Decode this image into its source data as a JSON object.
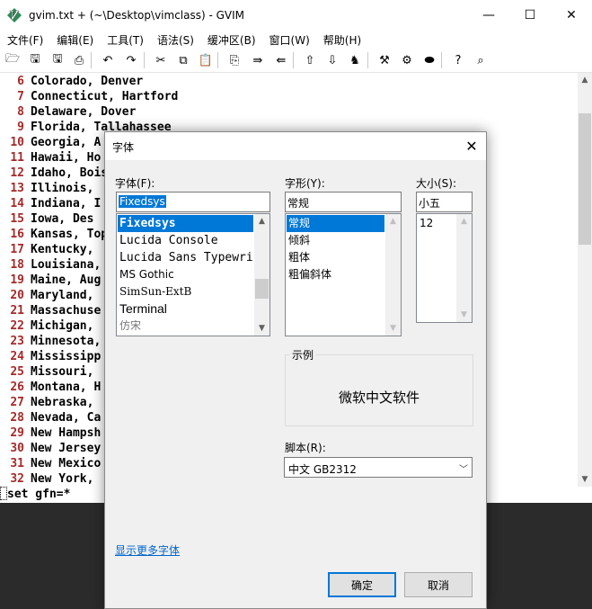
{
  "window": {
    "title": "gvim.txt + (~\\Desktop\\vimclass) - GVIM",
    "minimize_symbol": "—",
    "maximize_symbol": "☐",
    "close_symbol": "✕"
  },
  "menu": [
    "文件(F)",
    "编辑(E)",
    "工具(T)",
    "语法(S)",
    "缓冲区(B)",
    "窗口(W)",
    "帮助(H)"
  ],
  "toolbar": [
    {
      "name": "open-icon",
      "glyph": "🗁"
    },
    {
      "name": "save-icon",
      "glyph": "🖫"
    },
    {
      "name": "save-all-icon",
      "glyph": "🖫"
    },
    {
      "name": "print-icon",
      "glyph": "⎙"
    },
    {
      "name": "undo-icon",
      "glyph": "↶"
    },
    {
      "name": "redo-icon",
      "glyph": "↷"
    },
    {
      "name": "cut-icon",
      "glyph": "✂"
    },
    {
      "name": "copy-icon",
      "glyph": "⧉"
    },
    {
      "name": "paste-icon",
      "glyph": "📋"
    },
    {
      "name": "find-replace-icon",
      "glyph": "⎘"
    },
    {
      "name": "find-next-icon",
      "glyph": "⇛"
    },
    {
      "name": "find-prev-icon",
      "glyph": "⇚"
    },
    {
      "name": "load-session-icon",
      "glyph": "⇧"
    },
    {
      "name": "save-session-icon",
      "glyph": "⇩"
    },
    {
      "name": "run-script-icon",
      "glyph": "♞"
    },
    {
      "name": "make-icon",
      "glyph": "⚒"
    },
    {
      "name": "build-tags-icon",
      "glyph": "⚙"
    },
    {
      "name": "jump-tag-icon",
      "glyph": "⬬"
    },
    {
      "name": "help-icon",
      "glyph": "?"
    },
    {
      "name": "find-help-icon",
      "glyph": "⌕"
    }
  ],
  "editor": {
    "lines": [
      {
        "num": "6",
        "text": "Colorado, Denver"
      },
      {
        "num": "7",
        "text": "Connecticut, Hartford"
      },
      {
        "num": "8",
        "text": "Delaware, Dover"
      },
      {
        "num": "9",
        "text": "Florida, Tallahassee"
      },
      {
        "num": "10",
        "text": "Georgia, A"
      },
      {
        "num": "11",
        "text": "Hawaii, Ho"
      },
      {
        "num": "12",
        "text": "Idaho, Bois"
      },
      {
        "num": "13",
        "text": "Illinois,"
      },
      {
        "num": "14",
        "text": "Indiana, I"
      },
      {
        "num": "15",
        "text": "Iowa, Des"
      },
      {
        "num": "16",
        "text": "Kansas, Top"
      },
      {
        "num": "17",
        "text": "Kentucky,"
      },
      {
        "num": "18",
        "text": "Louisiana,"
      },
      {
        "num": "19",
        "text": "Maine, Aug"
      },
      {
        "num": "20",
        "text": "Maryland,"
      },
      {
        "num": "21",
        "text": "Massachuse"
      },
      {
        "num": "22",
        "text": "Michigan,"
      },
      {
        "num": "23",
        "text": "Minnesota,"
      },
      {
        "num": "24",
        "text": "Mississipp"
      },
      {
        "num": "25",
        "text": "Missouri,"
      },
      {
        "num": "26",
        "text": "Montana, H"
      },
      {
        "num": "27",
        "text": "Nebraska,"
      },
      {
        "num": "28",
        "text": "Nevada, Ca"
      },
      {
        "num": "29",
        "text": "New Hampsh"
      },
      {
        "num": "30",
        "text": "New Jersey"
      },
      {
        "num": "31",
        "text": "New Mexico"
      },
      {
        "num": "32",
        "text": "New York,"
      }
    ],
    "command_line": "set gfn=*"
  },
  "dialog": {
    "title": "字体",
    "font_label": "字体(F):",
    "font_value": "Fixedsys",
    "fonts": [
      "Fixedsys",
      "Lucida Console",
      "Lucida Sans Typewri",
      "MS Gothic",
      "SimSun-ExtB",
      "Terminal",
      "仿宋"
    ],
    "style_label": "字形(Y):",
    "style_value": "常规",
    "styles": [
      "常规",
      "倾斜",
      "粗体",
      "粗偏斜体"
    ],
    "size_label": "大小(S):",
    "size_value": "小五",
    "sizes": [
      "12"
    ],
    "sample_label": "示例",
    "sample_text": "微软中文软件",
    "script_label": "脚本(R):",
    "script_value": "中文 GB2312",
    "more_fonts_link": "显示更多字体",
    "ok_label": "确定",
    "cancel_label": "取消"
  }
}
